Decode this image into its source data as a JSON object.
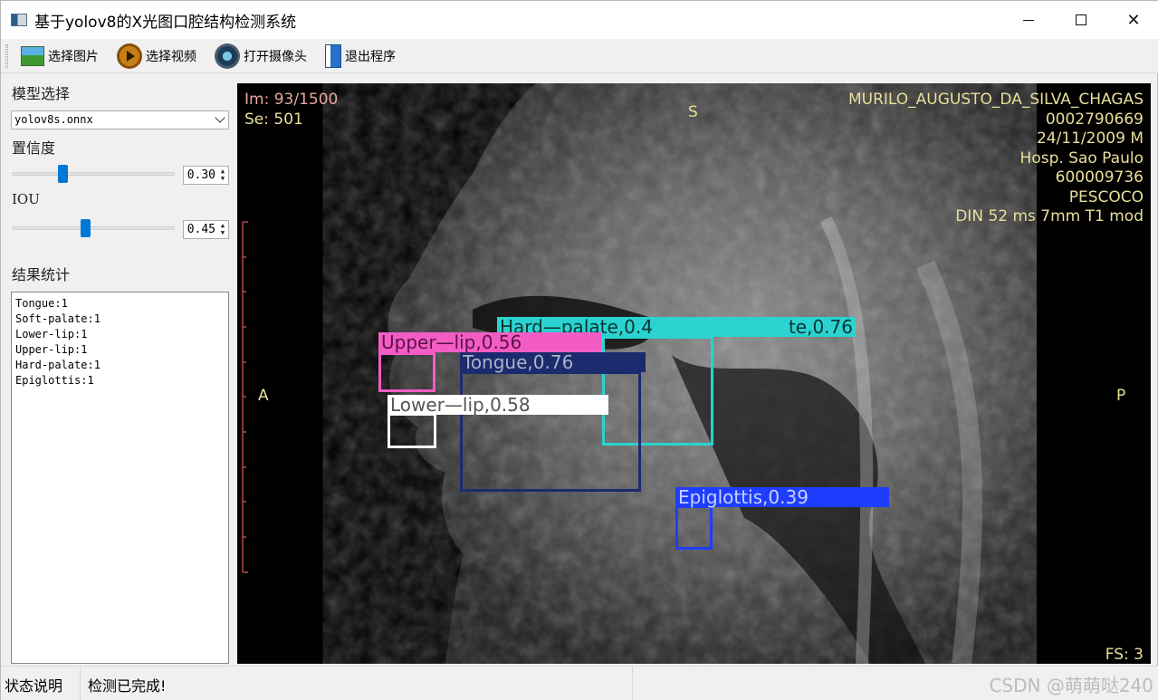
{
  "window": {
    "title": "基于yolov8的X光图口腔结构检测系统"
  },
  "toolbar": {
    "select_image": "选择图片",
    "select_video": "选择视频",
    "open_camera": "打开摄像头",
    "exit": "退出程序"
  },
  "sidebar": {
    "model_label": "模型选择",
    "model_value": "yolov8s.onnx",
    "confidence_label": "置信度",
    "confidence_value": "0.30",
    "confidence_fraction": 0.3,
    "iou_label": "IOU",
    "iou_value": "0.45",
    "iou_fraction": 0.45,
    "results_label": "结果统计",
    "results": [
      "Tongue:1",
      "Soft-palate:1",
      "Lower-lip:1",
      "Upper-lip:1",
      "Hard-palate:1",
      "Epiglottis:1"
    ]
  },
  "image_overlay": {
    "image_index": "Im: 93/1500",
    "series": "Se: 501",
    "top_center": "S",
    "patient_name": "MURILO_AUGUSTO_DA_SILVA_CHAGAS",
    "patient_id": "0002790669",
    "date_sex": "24/11/2009 M",
    "hospital": "Hosp. Sao Paulo",
    "accession": "600009736",
    "region": "PESCOCO",
    "sequence": "DIN  52 ms 7mm T1 mod",
    "left_marker": "A",
    "right_marker": "P",
    "fs": "FS: 3"
  },
  "detections": [
    {
      "label": "Hard—palate,0.4",
      "color": "#2ad3cf"
    },
    {
      "label": "te,0.76",
      "color": "#2ad3cf"
    },
    {
      "label": "Upper—lip,0.56",
      "color": "#f35cc4"
    },
    {
      "label": "Tongue,0.76",
      "color": "#1c2a6e"
    },
    {
      "label": "Lower—lip,0.58",
      "color": "#ffffff"
    },
    {
      "label": "Epiglottis,0.39",
      "color": "#1f3dff"
    }
  ],
  "statusbar": {
    "title": "状态说明",
    "message": "检测已完成!",
    "watermark": "CSDN @萌萌哒240"
  }
}
